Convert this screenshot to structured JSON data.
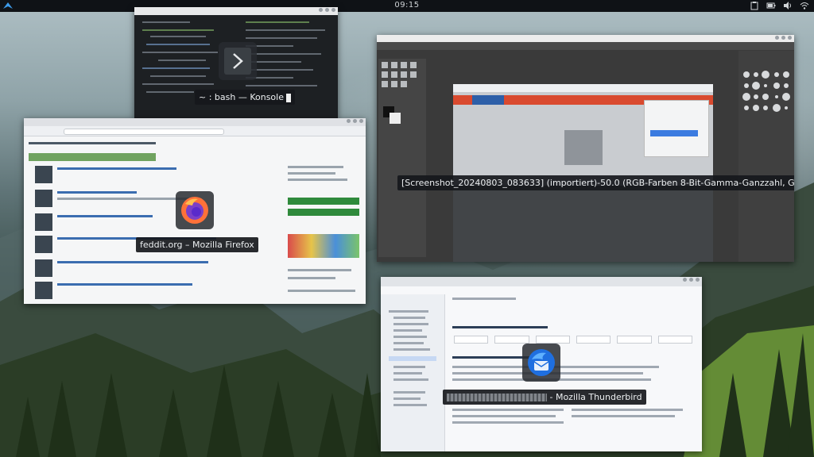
{
  "panel": {
    "clock": "09:15"
  },
  "windows": {
    "konsole": {
      "caption": "~ : bash — Konsole",
      "icon": "konsole-icon"
    },
    "firefox": {
      "caption": "feddit.org – Mozilla Firefox",
      "icon": "firefox-icon"
    },
    "gimp": {
      "caption": "[Screenshot_20240803_083633] (importiert)-50.0 (RGB-Farben 8-Bit-Gamma-Ganzzahl, G..."
    },
    "thunderbird": {
      "caption_suffix": "- Mozilla Thunderbird",
      "icon": "thunderbird-icon"
    }
  },
  "colors": {
    "panel": "#0f1216",
    "caption_bg": "#16181c",
    "firefox_orange": "#ff7139",
    "thunderbird_blue": "#1f6fe0"
  }
}
